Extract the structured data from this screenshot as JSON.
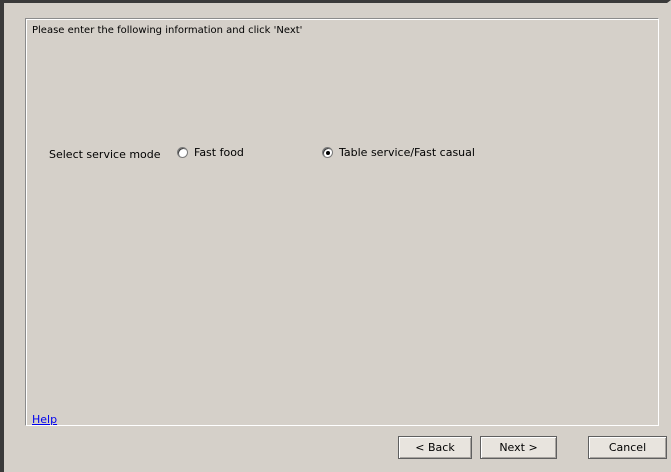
{
  "instructions": "Please enter the following information and click 'Next'",
  "service_mode": {
    "label": "Select service mode",
    "options": [
      {
        "label": "Fast food",
        "selected": false
      },
      {
        "label": "Table service/Fast casual",
        "selected": true
      }
    ]
  },
  "help_link": "Help",
  "buttons": {
    "back": "< Back",
    "next": "Next >",
    "cancel": "Cancel"
  },
  "colors": {
    "background": "#d5d0c9",
    "link": "#0000ee"
  }
}
